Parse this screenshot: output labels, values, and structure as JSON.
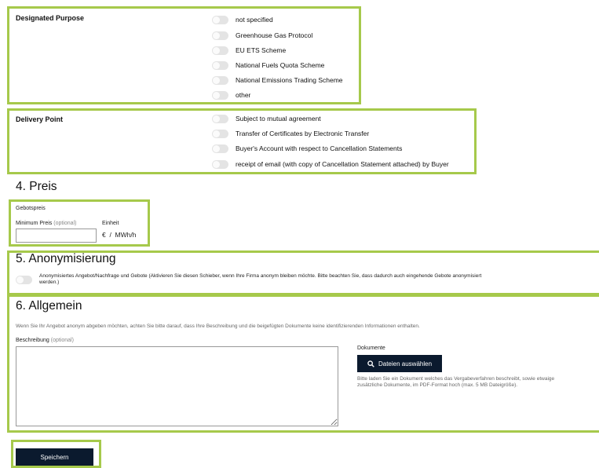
{
  "designated_purpose": {
    "label": "Designated Purpose",
    "options": [
      "not specified",
      "Greenhouse Gas Protocol",
      "EU ETS Scheme",
      "National Fuels Quota Scheme",
      "National Emissions Trading Scheme",
      "other"
    ]
  },
  "delivery_point": {
    "label": "Delivery Point",
    "options": [
      "Subject to mutual agreement",
      "Transfer of Certificates by Electronic Transfer",
      "Buyer's Account with respect to Cancellation Statements",
      "receipt of email (with copy of Cancellation Statement attached) by Buyer"
    ]
  },
  "preis": {
    "heading": "4. Preis",
    "sublabel": "Gebotspreis",
    "min_price_label": "Minimum Preis",
    "optional": "(optional)",
    "unit_label": "Einheit",
    "unit_value": "€  /  MWh/h",
    "min_price_value": ""
  },
  "anonym": {
    "heading": "5. Anonymisierung",
    "toggle_text_line1": "Anonymisiertes Angebot/Nachfrage und Gebote (Aktivieren Sie diesen Schieber, wenn Ihre Firma anonym bleiben möchte. Bitte beachten Sie, dass dadurch auch eingehende Gebote anonymisiert",
    "toggle_text_line2": "werden.)"
  },
  "allgemein": {
    "heading": "6. Allgemein",
    "hint": "Wenn Sie Ihr Angebot anonym abgeben möchten, achten Sie bitte darauf, dass Ihre Beschreibung und die beigefügten Dokumente keine identifizierenden Informationen enthalten.",
    "description_label": "Beschreibung",
    "optional": "(optional)",
    "description_value": "",
    "documents_label": "Dokumente",
    "upload_button": "Dateien auswählen",
    "upload_hint_line1": "Bitte laden Sie ein Dokument welches das Vergabeverfahren beschreibt, sowie etwaige",
    "upload_hint_line2": "zusätzliche Dokumente, im PDF-Format hoch (max. 5 MB Dateigröße)."
  },
  "actions": {
    "save_label": "Speichern"
  },
  "colors": {
    "highlight_border": "#a6c94b",
    "primary_button": "#0b1a2e",
    "toggle_off": "#e4e4e4"
  }
}
